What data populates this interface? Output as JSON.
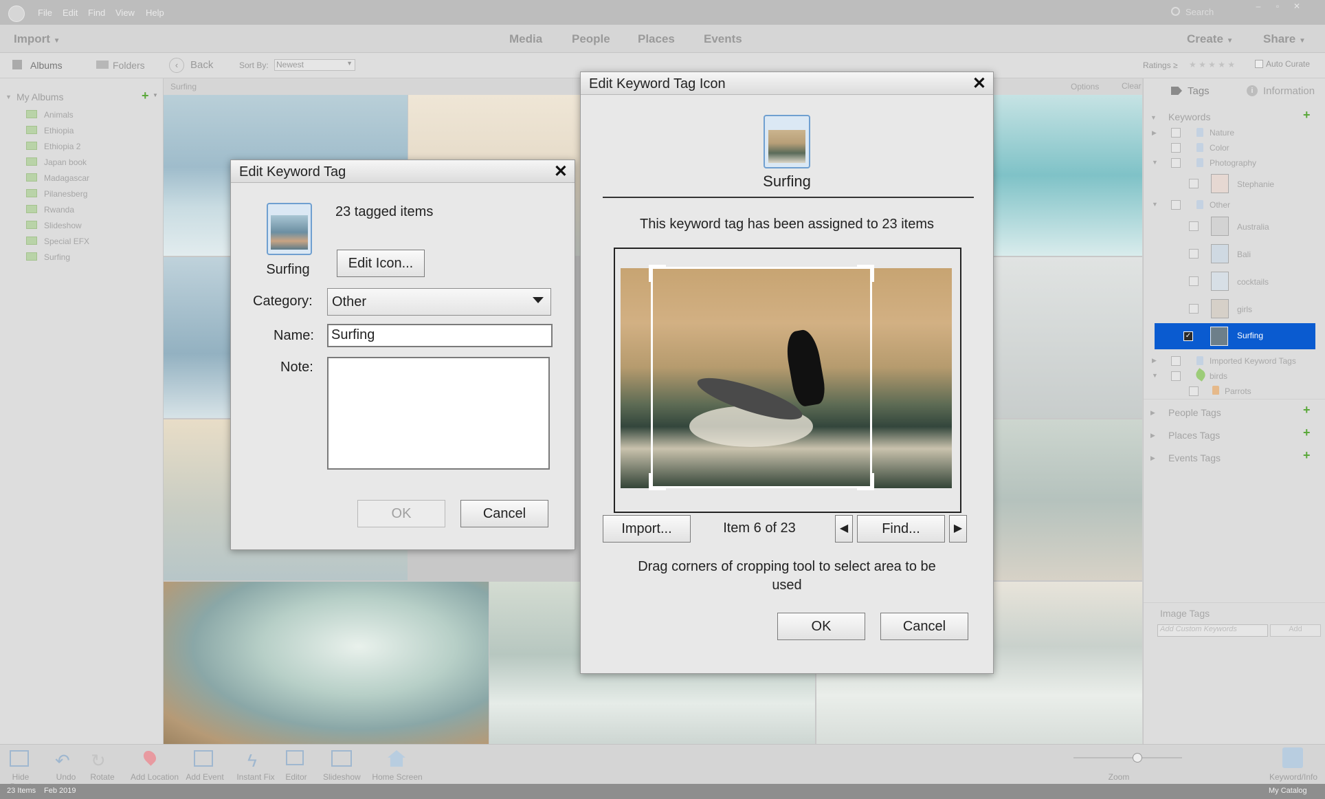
{
  "menu": {
    "file": "File",
    "edit": "Edit",
    "find": "Find",
    "view": "View",
    "help": "Help",
    "search_placeholder": "Search"
  },
  "topnav": {
    "import": "Import",
    "media": "Media",
    "people": "People",
    "places": "Places",
    "events": "Events",
    "create": "Create",
    "share": "Share"
  },
  "toolbar": {
    "albums": "Albums",
    "folders": "Folders",
    "back": "Back",
    "sort_by": "Sort By:",
    "sort_value": "Newest",
    "ratings": "Ratings ≥",
    "stars": "★ ★ ★ ★ ★",
    "auto_curate": "Auto Curate"
  },
  "left_panel": {
    "title": "My Albums",
    "albums": [
      "Animals",
      "Ethiopia",
      "Ethiopia 2",
      "Japan book",
      "Madagascar",
      "Pilanesberg",
      "Rwanda",
      "Slideshow",
      "Special EFX",
      "Surfing"
    ]
  },
  "media": {
    "header_label": "Surfing",
    "options": "Options",
    "clear": "Clear"
  },
  "right_panel": {
    "tags_tab": "Tags",
    "info_tab": "Information",
    "keywords": "Keywords",
    "items": [
      "Nature",
      "Color",
      "Photography",
      "Stephanie",
      "Other",
      "Australia",
      "Bali",
      "cocktails",
      "girls",
      "Surfing",
      "Imported Keyword Tags",
      "birds",
      "Parrots"
    ],
    "people_tags": "People Tags",
    "places_tags": "Places Tags",
    "events_tags": "Events Tags",
    "image_tags": "Image Tags",
    "custom_placeholder": "Add Custom Keywords",
    "add": "Add"
  },
  "bottom": {
    "hide_panel": "Hide Panel",
    "undo": "Undo",
    "rotate": "Rotate",
    "add_location": "Add Location",
    "add_event": "Add Event",
    "instant_fix": "Instant Fix",
    "editor": "Editor",
    "slideshow": "Slideshow",
    "home_screen": "Home Screen",
    "zoom": "Zoom",
    "keyword_info": "Keyword/Info"
  },
  "status": {
    "items": "23 Items",
    "date": "Feb 2019",
    "catalog": "My Catalog"
  },
  "dialog_edit_tag": {
    "title": "Edit Keyword Tag",
    "tag_name": "Surfing",
    "tagged_items": "23 tagged items",
    "edit_icon": "Edit Icon...",
    "category_label": "Category:",
    "category_value": "Other",
    "name_label": "Name:",
    "name_value": "Surfing",
    "note_label": "Note:",
    "note_value": "",
    "ok": "OK",
    "cancel": "Cancel"
  },
  "dialog_icon": {
    "title": "Edit Keyword Tag Icon",
    "tag_name": "Surfing",
    "assigned_text": "This keyword tag has been assigned to 23 items",
    "import": "Import...",
    "item_counter": "Item 6 of 23",
    "find": "Find...",
    "instructions": "Drag corners of cropping tool to select area to be used",
    "ok": "OK",
    "cancel": "Cancel"
  },
  "colors": {
    "selection": "#0a5bd0",
    "accent_green": "#5aa83a"
  }
}
